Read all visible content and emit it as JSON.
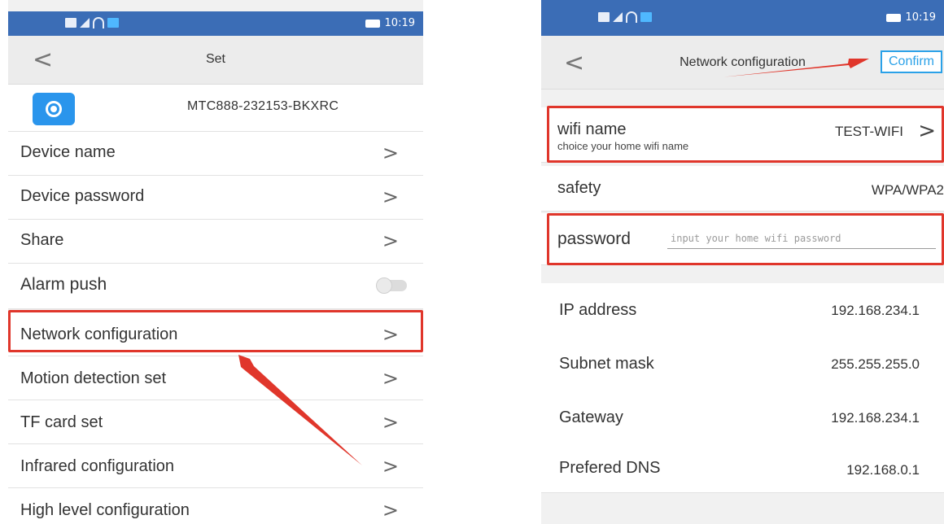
{
  "status_bar": {
    "time": "10:19"
  },
  "left": {
    "title": "Set",
    "back_label": "<",
    "device_id": "MTC888-232153-BKXRC",
    "items": [
      {
        "label": "Device name",
        "chevron": ">"
      },
      {
        "label": "Device password",
        "chevron": ">"
      },
      {
        "label": "Share",
        "chevron": ">"
      },
      {
        "label": "Alarm push",
        "toggle_on": false
      },
      {
        "label": "Network configuration",
        "chevron": ">"
      },
      {
        "label": "Motion detection set",
        "chevron": ">"
      },
      {
        "label": "TF card set",
        "chevron": ">"
      },
      {
        "label": "Infrared configuration",
        "chevron": ">"
      },
      {
        "label": "High level configuration",
        "chevron": ">"
      }
    ]
  },
  "right": {
    "title": "Network configuration",
    "back_label": "<",
    "confirm_label": "Confirm",
    "wifi": {
      "label": "wifi name",
      "value": "TEST-WIFI",
      "hint": "choice your home wifi name",
      "chevron": ">"
    },
    "safety": {
      "label": "safety",
      "value": "WPA/WPA2"
    },
    "password": {
      "label": "password",
      "placeholder": "input your home wifi password",
      "value": ""
    },
    "info": [
      {
        "label": "IP address",
        "value": "192.168.234.1"
      },
      {
        "label": "Subnet mask",
        "value": "255.255.255.0"
      },
      {
        "label": "Gateway",
        "value": "192.168.234.1"
      },
      {
        "label": "Prefered DNS",
        "value": "192.168.0.1"
      }
    ]
  },
  "colors": {
    "highlight": "#e0362b",
    "status_bar": "#3b6db6",
    "accent": "#2aa1e8"
  }
}
